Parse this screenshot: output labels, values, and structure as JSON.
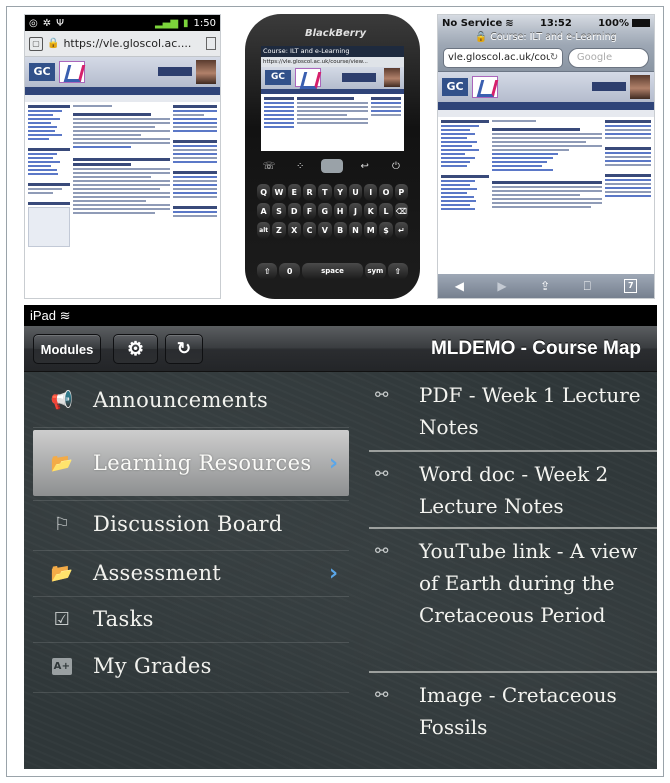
{
  "android": {
    "status_time": "1:50",
    "url": "https://vle.gloscol.ac...."
  },
  "blackberry": {
    "brand": "BlackBerry",
    "screen_title": "Course: ILT and e-Learning",
    "url": "https://vle.gloscol.ac.uk/course/view...",
    "keys_row1": [
      "Q",
      "W",
      "E",
      "R",
      "T",
      "Y",
      "U",
      "I",
      "O",
      "P"
    ],
    "keys_row2": [
      "A",
      "S",
      "D",
      "F",
      "G",
      "H",
      "J",
      "K",
      "L",
      "⌫"
    ],
    "keys_row3": [
      "alt",
      "Z",
      "X",
      "C",
      "V",
      "B",
      "N",
      "M",
      "$",
      "↵"
    ],
    "space_label": "space",
    "sym_label": "sym"
  },
  "ios": {
    "carrier": "No Service",
    "time": "13:52",
    "battery": "100%",
    "page_title": "Course: ILT and e-Learning",
    "url": "vle.gloscol.ac.uk/cour...",
    "search_placeholder": "Google"
  },
  "ipad": {
    "status_label": "iPad",
    "modules_label": "Modules",
    "title": "MLDEMO - Course Map",
    "menu_items": [
      {
        "label": "Announcements",
        "icon": "megaphone-icon",
        "selected": false,
        "has_chevron": false
      },
      {
        "label": "Learning Resources",
        "icon": "folder-icon",
        "selected": true,
        "has_chevron": true
      },
      {
        "label": "Discussion Board",
        "icon": "discussion-icon",
        "selected": false,
        "has_chevron": false
      },
      {
        "label": "Assessment",
        "icon": "folder-icon",
        "selected": false,
        "has_chevron": true
      },
      {
        "label": "Tasks",
        "icon": "checkbox-icon",
        "selected": false,
        "has_chevron": false
      },
      {
        "label": "My Grades",
        "icon": "grade-icon",
        "selected": false,
        "has_chevron": false
      }
    ],
    "resources": [
      {
        "label": "PDF - Week 1 Lecture Notes",
        "icon": "link-icon"
      },
      {
        "label": "Word doc - Week 2 Lecture Notes",
        "icon": "link-icon"
      },
      {
        "label": "YouTube link - A view of Earth during the Cretaceous Period",
        "icon": "link-icon"
      },
      {
        "label": "Image - Cretaceous Fossils",
        "icon": "link-icon"
      }
    ]
  }
}
